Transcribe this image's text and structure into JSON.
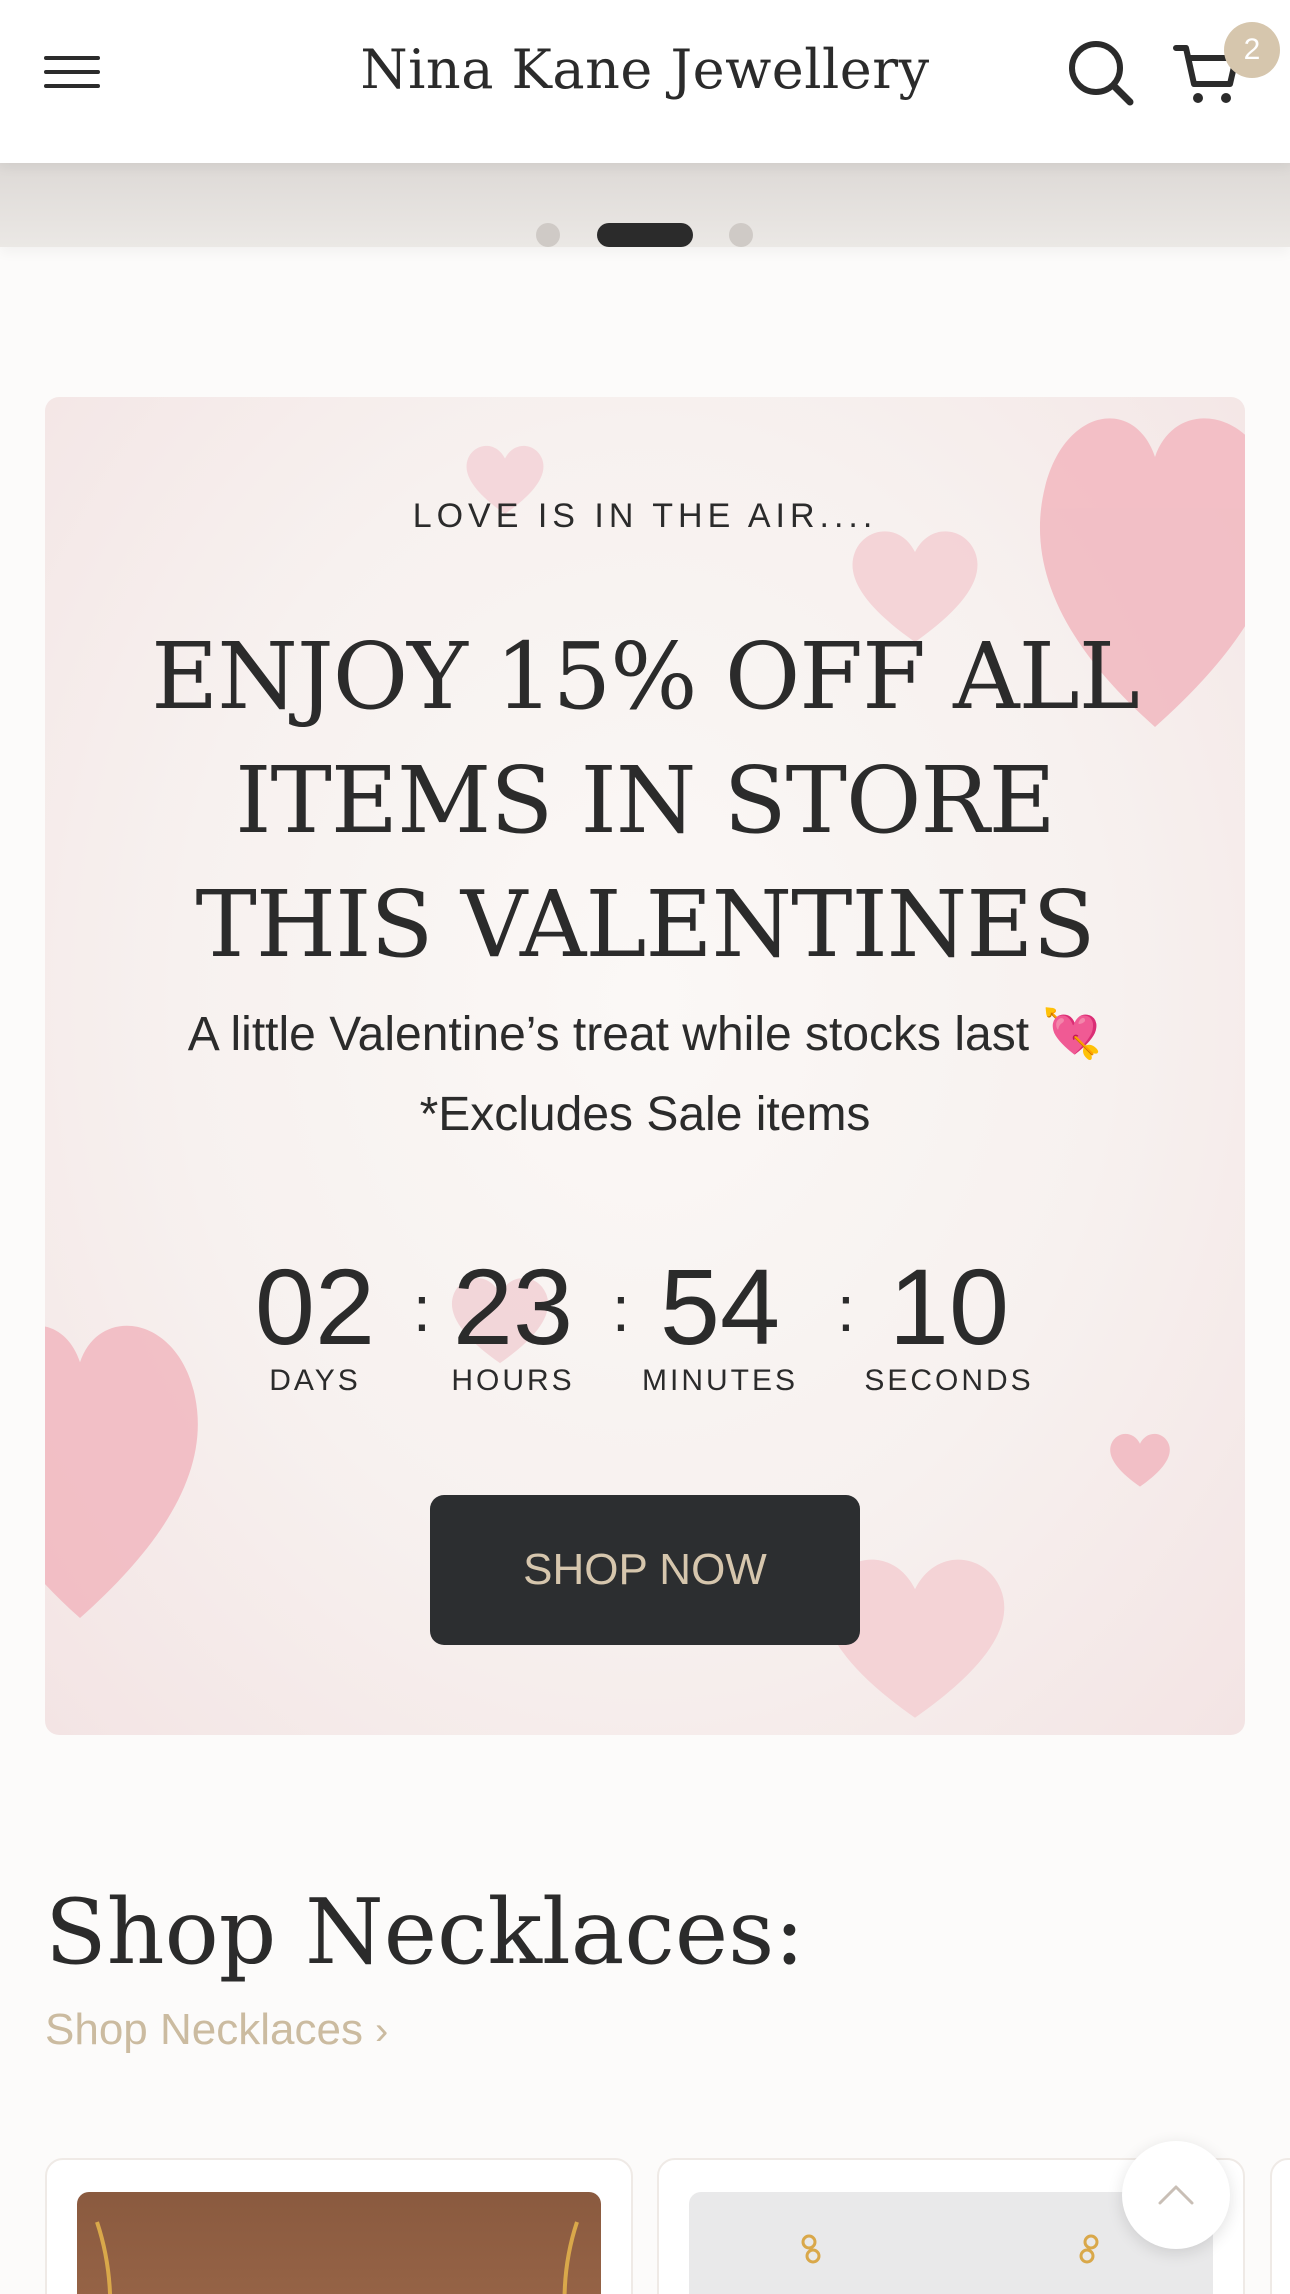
{
  "header": {
    "brand": "Nina Kane Jewellery",
    "menu_icon": "hamburger-menu-icon",
    "search_icon": "search-icon",
    "cart_icon": "cart-icon",
    "cart_count": "2"
  },
  "slideshow": {
    "dots": 3,
    "active_dot": 2
  },
  "promo": {
    "eyebrow": "LOVE IS IN THE AIR....",
    "title": "ENJOY 15% OFF ALL ITEMS IN STORE THIS VALENTINES",
    "subtitle_line1": "A little Valentine’s treat while stocks last 💘",
    "subtitle_line2": "*Excludes Sale items",
    "countdown": {
      "days": "02",
      "days_label": "DAYS",
      "hours": "23",
      "hours_label": "HOURS",
      "minutes": "54",
      "minutes_label": "MINUTES",
      "seconds": "10",
      "seconds_label": "SECONDS",
      "separator": ":"
    },
    "cta_label": "SHOP NOW"
  },
  "section": {
    "title": "Shop Necklaces:",
    "link_label": "Shop Necklaces"
  },
  "colors": {
    "accent_beige": "#d6c6ad",
    "button_dark": "#2c2e30",
    "text_dark": "#2b2b2b",
    "heart_pink": "#f2b8c0"
  },
  "icons": {
    "back_to_top": "chevron-up-icon",
    "link_chevron": "chevron-right-icon"
  }
}
